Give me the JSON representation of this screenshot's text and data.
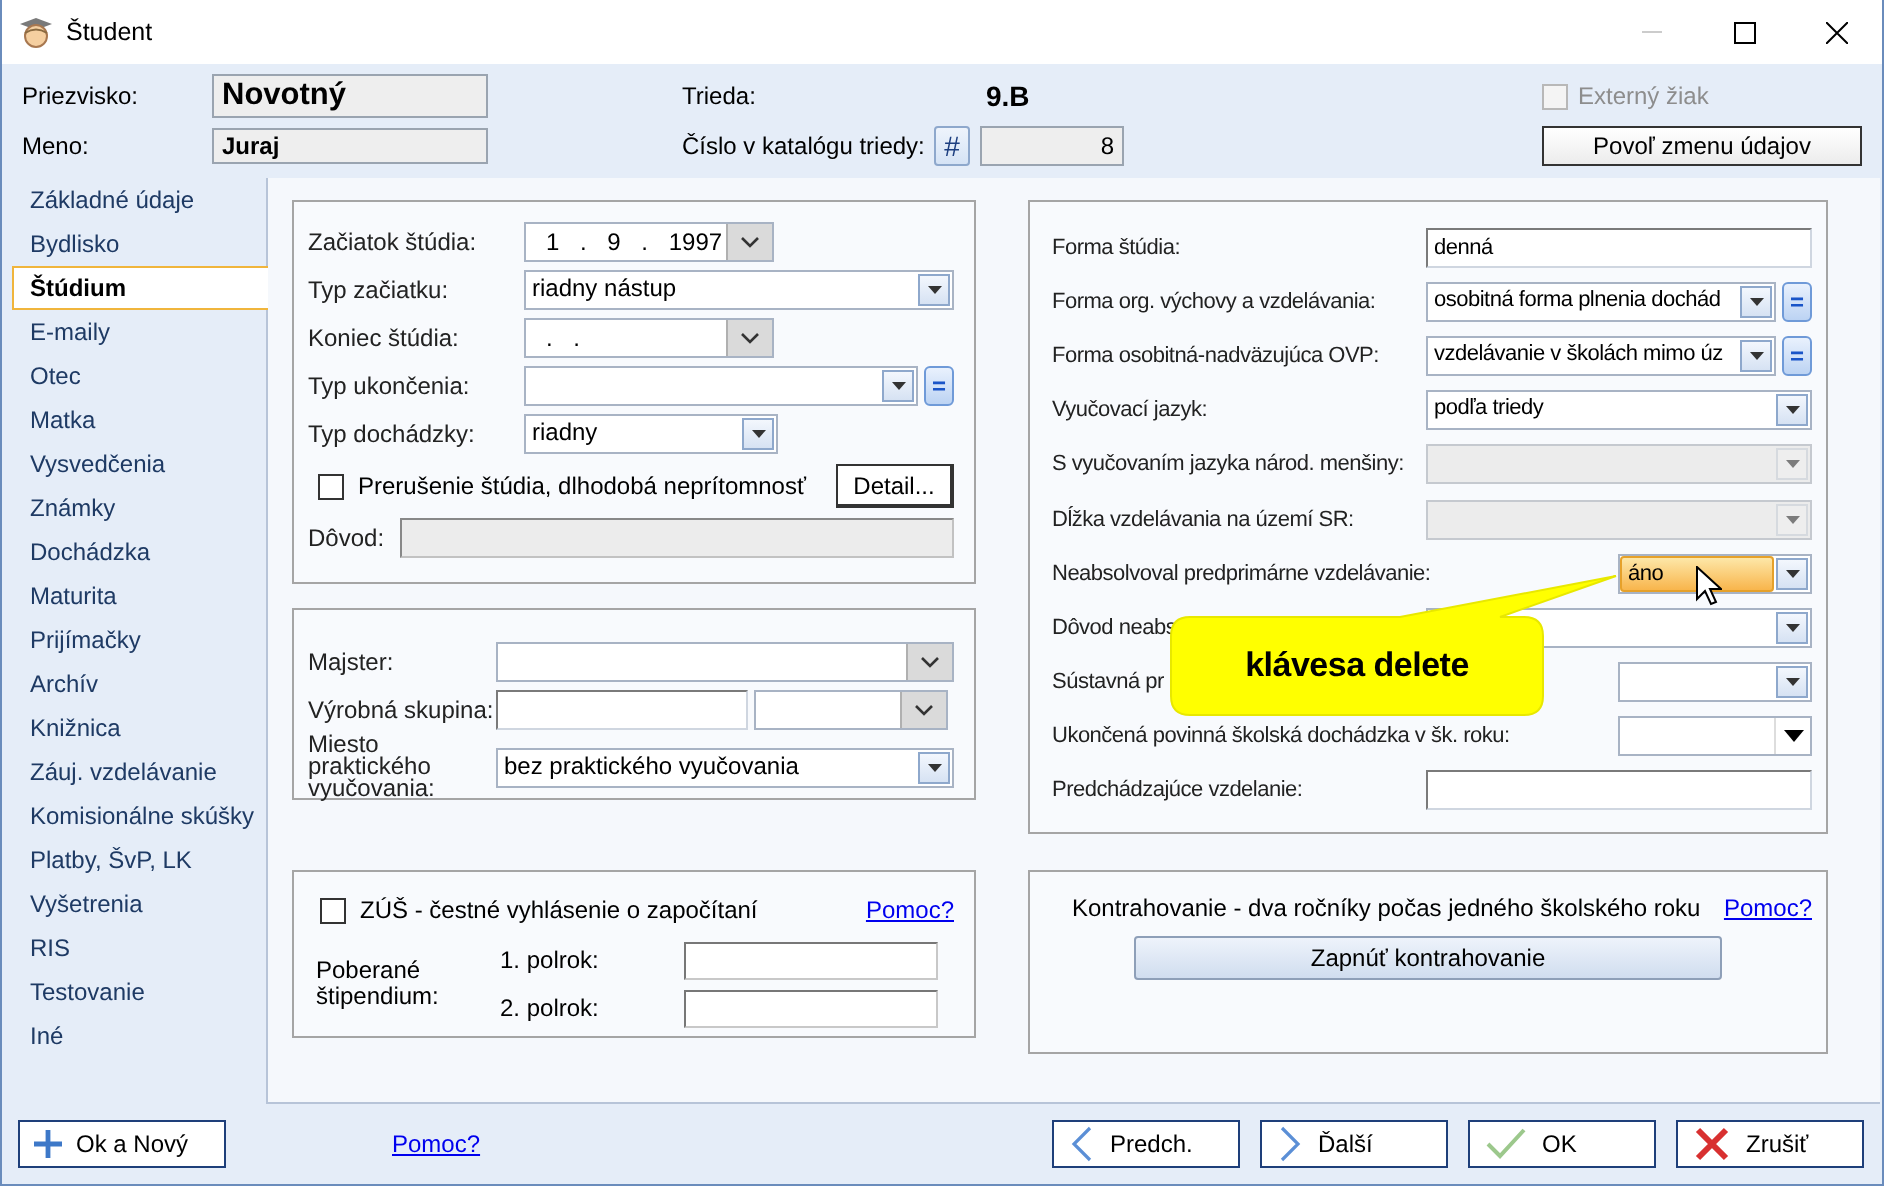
{
  "window": {
    "title": "Študent"
  },
  "header": {
    "surname": {
      "label": "Priezvisko:",
      "value": "Novotný"
    },
    "first_name": {
      "label": "Meno:",
      "value": "Juraj"
    },
    "class": {
      "label": "Trieda:",
      "value": "9.B"
    },
    "catalog": {
      "label": "Číslo v katalógu triedy:",
      "button": "#",
      "value": "8"
    },
    "external_student": {
      "label": "Externý žiak",
      "checked": false,
      "disabled": true
    },
    "allow_edit_button": "Povoľ zmenu údajov"
  },
  "sidebar": {
    "items": [
      {
        "label": "Základné údaje",
        "selected": false
      },
      {
        "label": "Bydlisko",
        "selected": false
      },
      {
        "label": "Štúdium",
        "selected": true
      },
      {
        "label": "E-maily",
        "selected": false
      },
      {
        "label": "Otec",
        "selected": false
      },
      {
        "label": "Matka",
        "selected": false
      },
      {
        "label": "Vysvedčenia",
        "selected": false
      },
      {
        "label": "Známky",
        "selected": false
      },
      {
        "label": "Dochádzka",
        "selected": false
      },
      {
        "label": "Maturita",
        "selected": false
      },
      {
        "label": "Prijímačky",
        "selected": false
      },
      {
        "label": "Archív",
        "selected": false
      },
      {
        "label": "Knižnica",
        "selected": false
      },
      {
        "label": "Záuj. vzdelávanie",
        "selected": false
      },
      {
        "label": "Komisionálne skúšky",
        "selected": false
      },
      {
        "label": "Platby, ŠvP, LK",
        "selected": false
      },
      {
        "label": "Vyšetrenia",
        "selected": false
      },
      {
        "label": "RIS",
        "selected": false
      },
      {
        "label": "Testovanie",
        "selected": false
      },
      {
        "label": "Iné",
        "selected": false
      }
    ]
  },
  "study": {
    "rows": [
      {
        "label": "Začiatok štúdia:",
        "controls": [
          {
            "kind": "date",
            "value": "1 . 9 . 1997"
          }
        ]
      },
      {
        "label": "Typ začiatku:",
        "controls": [
          {
            "kind": "combo",
            "value": "riadny nástup"
          }
        ]
      },
      {
        "label": "Koniec štúdia:",
        "controls": [
          {
            "kind": "date",
            "value": ". ."
          }
        ]
      },
      {
        "label": "Typ ukončenia:",
        "controls": [
          {
            "kind": "combo",
            "button": "="
          }
        ]
      },
      {
        "label": "Typ dochádzky:",
        "controls": [
          {
            "kind": "combo",
            "value": "riadny"
          }
        ]
      }
    ],
    "interruption": {
      "label": "Prerušenie štúdia, dlhodobá neprítomnosť",
      "checked": false
    },
    "detail_button": "Detail...",
    "reason": {
      "label": "Dôvod:",
      "disabled": true
    }
  },
  "practical": {
    "rows": [
      {
        "label": "Majster:",
        "controls": [
          {
            "kind": "dropdown"
          }
        ]
      },
      {
        "label": "Výrobná skupina:",
        "controls": [
          {
            "kind": "text"
          },
          {
            "kind": "dropdown"
          }
        ]
      },
      {
        "label": "Miesto praktického vyučovania:",
        "controls": [
          {
            "kind": "combo",
            "value": "bez praktického vyučovania"
          }
        ]
      }
    ]
  },
  "art_school": {
    "checkbox": {
      "label": "ZÚŠ - čestné vyhlásenie o započítaní",
      "checked": false
    },
    "help_link": "Pomoc?",
    "scholarship_label": "Poberané štipendium:",
    "terms": [
      {
        "label": "1. polrok:"
      },
      {
        "label": "2. polrok:"
      }
    ]
  },
  "details": {
    "rows": [
      {
        "label": "Forma štúdia:",
        "controls": [
          {
            "kind": "text",
            "value": "denná",
            "disabled": false
          }
        ]
      },
      {
        "label": "Forma org. výchovy a vzdelávania:",
        "controls": [
          {
            "kind": "combo",
            "value": "osobitná forma plnenia dochád",
            "button": "=",
            "disabled": false
          }
        ]
      },
      {
        "label": "Forma osobitná-nadväzujúca OVP:",
        "controls": [
          {
            "kind": "combo",
            "value": "vzdelávanie v školách mimo úz",
            "button": "=",
            "disabled": false
          }
        ]
      },
      {
        "label": "Vyučovací jazyk:",
        "controls": [
          {
            "kind": "combo",
            "value": "podľa triedy",
            "disabled": false
          }
        ]
      },
      {
        "label": "S vyučovaním jazyka národ. menšiny:",
        "controls": [
          {
            "kind": "combo",
            "disabled": true
          }
        ]
      },
      {
        "label": "Dĺžka vzdelávania na území SR:",
        "controls": [
          {
            "kind": "combo",
            "disabled": true
          }
        ]
      },
      {
        "label": "Neabsolvoval predprimárne vzdelávanie:",
        "controls": [
          {
            "kind": "combo",
            "value": "áno",
            "disabled": false,
            "highlighted": true
          }
        ]
      },
      {
        "label": "Dôvod neabs",
        "controls": [
          {
            "kind": "combo",
            "disabled": false
          }
        ]
      },
      {
        "label": "Sústavná pr",
        "controls": [
          {
            "kind": "combo",
            "disabled": false
          }
        ]
      },
      {
        "label": "Ukončená povinná školská dochádzka v šk. roku:",
        "controls": [
          {
            "kind": "dropdown_dark",
            "disabled": false
          }
        ]
      },
      {
        "label": "Predchádzajúce vzdelanie:",
        "controls": [
          {
            "kind": "text",
            "disabled": false
          }
        ]
      }
    ],
    "tooltip": "klávesa delete"
  },
  "contract": {
    "text": "Kontrahovanie - dva ročníky počas jedného školského roku",
    "help_link": "Pomoc?",
    "button": "Zapnúť kontrahovanie"
  },
  "footer": {
    "new_button": {
      "label": "Ok a Nový",
      "kind": "add"
    },
    "help_link": "Pomoc?",
    "buttons": [
      {
        "label": "Predch.",
        "kind": "prev"
      },
      {
        "label": "Ďalší",
        "kind": "next"
      },
      {
        "label": "OK",
        "kind": "ok"
      },
      {
        "label": "Zrušiť",
        "kind": "cancel"
      }
    ]
  }
}
